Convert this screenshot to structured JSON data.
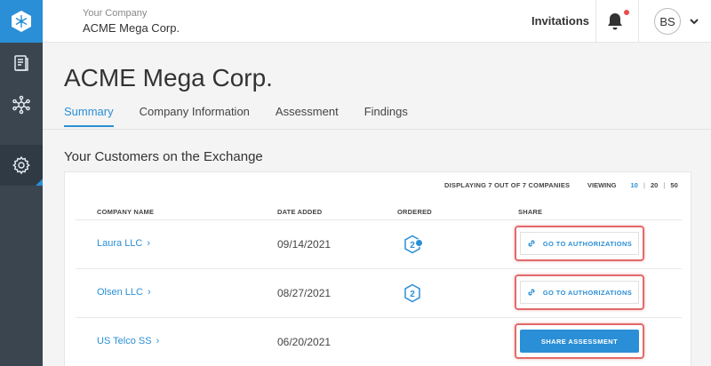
{
  "sidebar": {
    "items": [
      {
        "icon": "document-icon"
      },
      {
        "icon": "network-icon"
      },
      {
        "icon": "gear-icon",
        "active": true
      }
    ]
  },
  "header": {
    "company_label": "Your Company",
    "company_name": "ACME Mega Corp.",
    "invitations": "Invitations",
    "avatar_initials": "BS"
  },
  "page": {
    "title": "ACME Mega Corp.",
    "tabs": [
      {
        "label": "Summary",
        "active": true
      },
      {
        "label": "Company Information"
      },
      {
        "label": "Assessment"
      },
      {
        "label": "Findings"
      }
    ],
    "section_title": "Your Customers on the Exchange"
  },
  "table": {
    "display_count": "DISPLAYING 7 OUT OF 7 COMPANIES",
    "viewing_label": "VIEWING",
    "viewing_options": [
      "10",
      "20",
      "50"
    ],
    "viewing_active": "10",
    "columns": [
      "COMPANY NAME",
      "DATE ADDED",
      "ORDERED",
      "SHARE"
    ],
    "rows": [
      {
        "name": "Laura LLC",
        "date": "09/14/2021",
        "ordered": "2",
        "badge": true,
        "action": "GO TO AUTHORIZATIONS"
      },
      {
        "name": "Olsen LLC",
        "date": "08/27/2021",
        "ordered": "2",
        "badge": false,
        "action": "GO TO AUTHORIZATIONS"
      },
      {
        "name": "US Telco SS",
        "date": "06/20/2021",
        "ordered": "",
        "badge": false,
        "action": "SHARE ASSESSMENT"
      }
    ]
  },
  "colors": {
    "accent": "#2a8fd6",
    "sidebar": "#3a4550",
    "highlight": "#e26a6a"
  }
}
